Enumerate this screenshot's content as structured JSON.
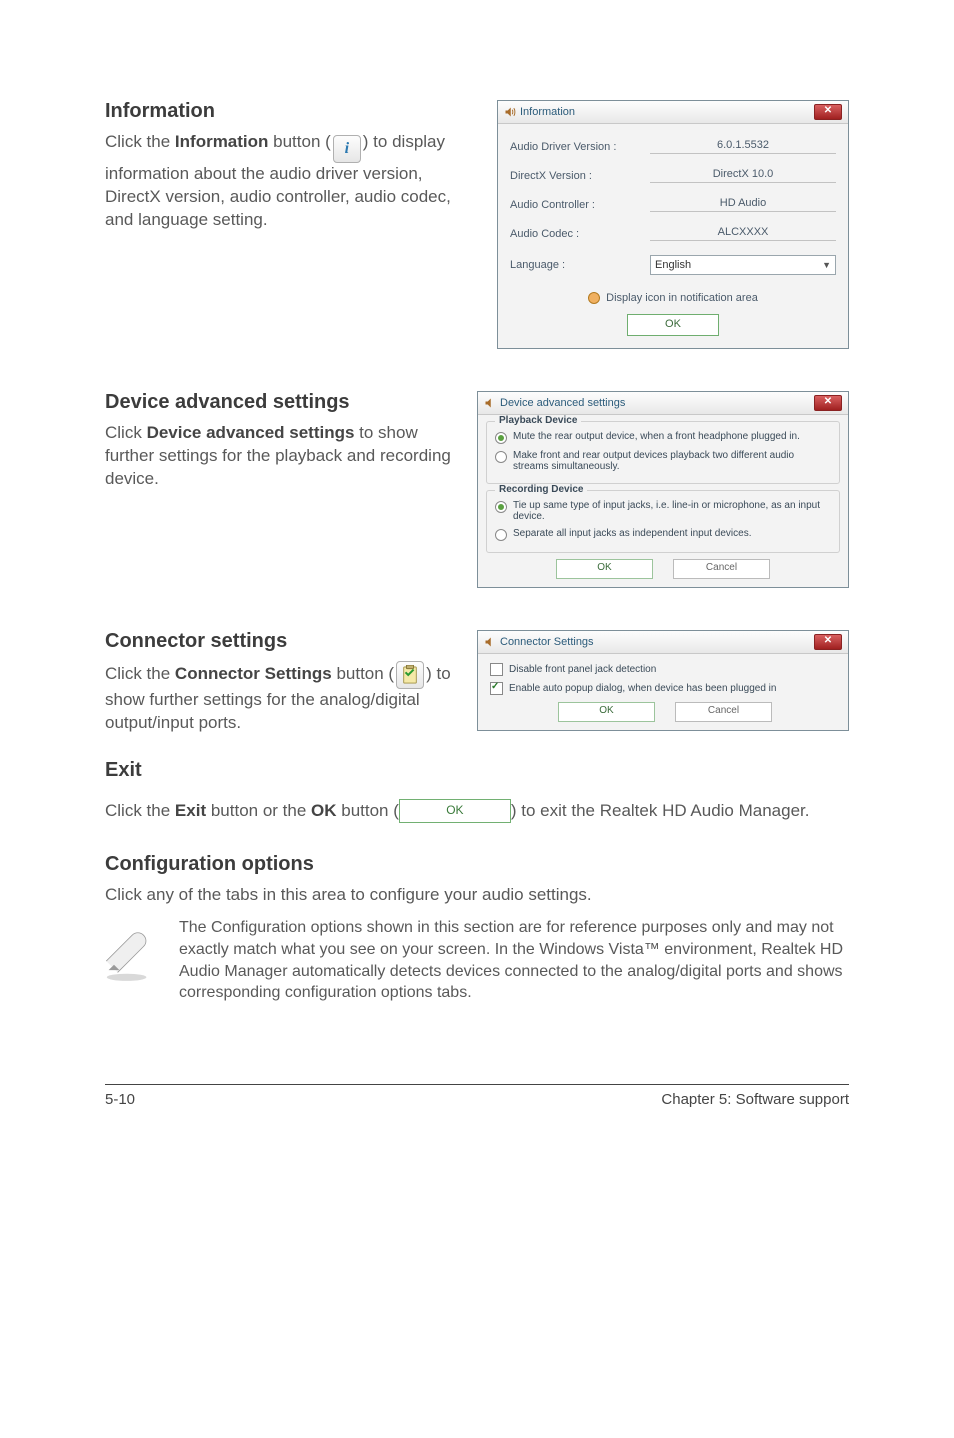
{
  "sections": {
    "information": {
      "heading": "Information",
      "para_before_icon": "Click the ",
      "bold1": "Information",
      "para_mid": " button (",
      "para_after_icon": ") to display information about the audio driver version, DirectX version, audio controller, audio codec, and language setting."
    },
    "device_adv": {
      "heading": "Device advanced settings",
      "para_before": "Click ",
      "bold": "Device advanced settings",
      "para_after": " to show further settings for the playback and recording device."
    },
    "connector": {
      "heading": "Connector settings",
      "para_before": "Click the ",
      "bold": "Connector Settings",
      "para_mid": " button (",
      "para_after": ") to show further settings for the analog/digital output/input ports."
    },
    "exit": {
      "heading": "Exit",
      "line_before": "Click the ",
      "bold1": "Exit",
      "line_mid1": " button or the ",
      "bold2": "OK",
      "line_mid2": " button (",
      "line_after": ") to exit the Realtek HD Audio Manager.",
      "ok_label": "OK"
    },
    "config": {
      "heading": "Configuration options",
      "line": "Click any of the tabs in this area to configure your audio settings.",
      "note": "The Configuration options shown in this section are for reference purposes only and may not exactly match what you see on your screen. In the Windows Vista™ environment, Realtek HD Audio Manager automatically detects devices connected to the analog/digital ports and shows corresponding  configuration options tabs."
    }
  },
  "info_dialog": {
    "title": "Information",
    "rows": {
      "driver_label": "Audio Driver Version :",
      "driver_value": "6.0.1.5532",
      "directx_label": "DirectX Version :",
      "directx_value": "DirectX 10.0",
      "controller_label": "Audio Controller :",
      "controller_value": "HD Audio",
      "codec_label": "Audio Codec :",
      "codec_value": "ALCXXXX",
      "language_label": "Language :",
      "language_value": "English"
    },
    "display_icon_label": "Display icon in notification area",
    "ok": "OK"
  },
  "das_dialog": {
    "title": "Device advanced settings",
    "playback_legend": "Playback Device",
    "playback_opt1": "Mute the rear output device, when a front headphone plugged in.",
    "playback_opt2": "Make front and rear output devices playback two different audio streams simultaneously.",
    "recording_legend": "Recording Device",
    "recording_opt1": "Tie up same type of input jacks, i.e. line-in or microphone, as an input device.",
    "recording_opt2": "Separate all input jacks as independent input devices.",
    "ok": "OK",
    "cancel": "Cancel"
  },
  "cs_dialog": {
    "title": "Connector Settings",
    "opt1": "Disable front panel jack detection",
    "opt2": "Enable auto popup dialog, when device has been plugged in",
    "ok": "OK",
    "cancel": "Cancel"
  },
  "footer": {
    "left": "5-10",
    "right": "Chapter 5: Software support"
  }
}
